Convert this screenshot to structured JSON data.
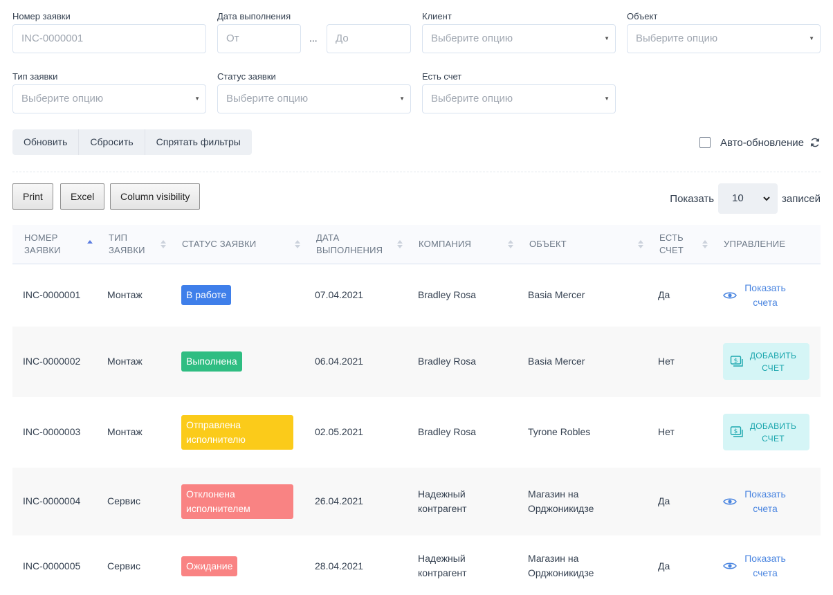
{
  "filters": {
    "request_number": {
      "label": "Номер заявки",
      "placeholder": "INC-0000001"
    },
    "date": {
      "label": "Дата выполнения",
      "from_placeholder": "От",
      "separator": "...",
      "to_placeholder": "До"
    },
    "client": {
      "label": "Клиент",
      "placeholder": "Выберите опцию"
    },
    "object": {
      "label": "Объект",
      "placeholder": "Выберите опцию"
    },
    "request_type": {
      "label": "Тип заявки",
      "placeholder": "Выберите опцию"
    },
    "request_status": {
      "label": "Статус заявки",
      "placeholder": "Выберите опцию"
    },
    "has_invoice": {
      "label": "Есть счет",
      "placeholder": "Выберите опцию"
    }
  },
  "actions": {
    "refresh": "Обновить",
    "reset": "Сбросить",
    "hide_filters": "Спрятать фильтры"
  },
  "auto_refresh": {
    "label": "Авто-обновление",
    "checked": false
  },
  "export_buttons": {
    "print": "Print",
    "excel": "Excel",
    "column_visibility": "Column visibility"
  },
  "length": {
    "show_label": "Показать",
    "value": "10",
    "records_label": "записей"
  },
  "table": {
    "columns": {
      "number": [
        "Номер",
        "заявки"
      ],
      "type": [
        "Тип",
        "заявки"
      ],
      "status": "Статус заявки",
      "date": [
        "Дата",
        "выполнения"
      ],
      "company": "Компания",
      "object": "Объект",
      "invoice": [
        "Есть",
        "счет"
      ],
      "manage": "Управление"
    },
    "rows": [
      {
        "number": "INC-0000001",
        "type": "Монтаж",
        "status": "В работе",
        "date": "07.04.2021",
        "company": "Bradley Rosa",
        "object": "Basia Mercer",
        "invoice": "Да",
        "action": [
          "Показать",
          "счета"
        ]
      },
      {
        "number": "INC-0000002",
        "type": "Монтаж",
        "status": "Выполнена",
        "date": "06.04.2021",
        "company": "Bradley Rosa",
        "object": "Basia Mercer",
        "invoice": "Нет",
        "action": [
          "Добавить",
          "счет"
        ]
      },
      {
        "number": "INC-0000003",
        "type": "Монтаж",
        "status": [
          "Отправлена",
          "исполнителю"
        ],
        "date": "02.05.2021",
        "company": "Bradley Rosa",
        "object": "Tyrone Robles",
        "invoice": "Нет",
        "action": [
          "Добавить",
          "счет"
        ]
      },
      {
        "number": "INC-0000004",
        "type": "Сервис",
        "status": [
          "Отклонена",
          "исполнителем"
        ],
        "date": "26.04.2021",
        "company": [
          "Надежный",
          "контрагент"
        ],
        "object": [
          "Магазин на",
          "Орджоникидзе"
        ],
        "invoice": "Да",
        "action": [
          "Показать",
          "счета"
        ]
      },
      {
        "number": "INC-0000005",
        "type": "Сервис",
        "status": "Ожидание",
        "date": "28.04.2021",
        "company": [
          "Надежный",
          "контрагент"
        ],
        "object": [
          "Магазин на",
          "Орджоникидзе"
        ],
        "invoice": "Да",
        "action": [
          "Показать",
          "счета"
        ]
      }
    ]
  },
  "colors": {
    "status_in_progress": "#3f7fea",
    "status_done": "#2fbd82",
    "status_sent": "#fbcb1a",
    "status_rejected": "#f98383",
    "status_waiting": "#f98383",
    "link": "#4a85e0",
    "add_invoice_bg": "#d5f5f6",
    "add_invoice_text": "#1aa6ad"
  },
  "icons": {
    "select_caret": "caret-down-icon",
    "refresh": "refresh-icon",
    "sort": "sort-icon",
    "view": "eye-icon",
    "add_invoice": "money-bill-icon"
  }
}
